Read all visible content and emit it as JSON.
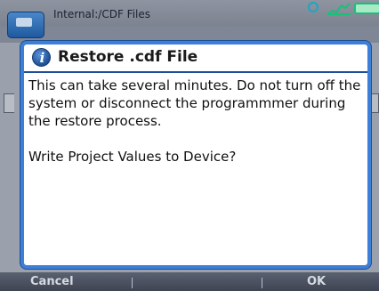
{
  "status_bar": {
    "location": "Internal:/CDF Files",
    "icons": [
      "app-folder-icon",
      "search-icon",
      "signal-icon",
      "battery-icon"
    ],
    "accent_colors": {
      "search": "#1aa7c4",
      "battery": "#19c07a"
    }
  },
  "dialog": {
    "icon": "info-icon",
    "icon_glyph": "i",
    "title": "Restore .cdf File",
    "message": "This can take several minutes. Do not turn off the system or disconnect the programmmer during the restore process.",
    "question": "Write Project Values to Device?",
    "border_color": "#3d7ed6"
  },
  "softkeys": {
    "left_label": "Cancel",
    "right_label": "OK"
  }
}
